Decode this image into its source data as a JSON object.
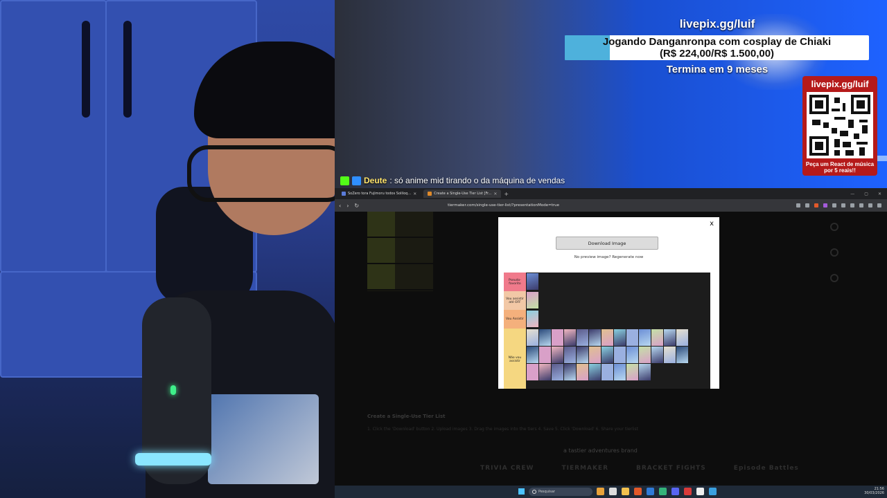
{
  "overlay": {
    "livepix_handle": "livepix.gg/luif",
    "goal_title": "Jogando Danganronpa com cosplay de Chiaki",
    "goal_progress_text": "(R$ 224,00/R$ 1.500,00)",
    "goal_progress_fraction": 0.149,
    "goal_ends": "Termina em 9 meses",
    "qr_title": "livepix.gg/luif",
    "qr_caption": "Peça um React de música por 5 reais!!"
  },
  "chat": {
    "username": "Deute",
    "message": ": só anime mid tirando o da máquina de vendas"
  },
  "browser": {
    "tabs": [
      {
        "label": "SoZero tora Fujimoru todos Soliloq...",
        "active": false
      },
      {
        "label": "Create a Single-Use Tier List [Fr...",
        "active": true
      }
    ],
    "url": "tiermaker.com/single-use-tier-list/?presentationMode=true",
    "modal": {
      "close": "x",
      "download_button": "Download Image",
      "preview_note": "No preview image? Regenerate now",
      "tiers": [
        {
          "label": "Pseudo-favorito",
          "color": "#f07a8b",
          "thumbs": 1
        },
        {
          "label": "Vou assistir até OFF",
          "color": "#f2c8a6",
          "thumbs": 1
        },
        {
          "label": "Vou Assistir",
          "color": "#f4b07c",
          "thumbs": 1
        },
        {
          "label": "Não vou assistir",
          "color": "#f5d781",
          "thumbs": 36
        }
      ]
    },
    "page": {
      "section_title": "Create a Single-Use Tier List",
      "steps": "1. Click the 'Download' button   2. Upload images   3. Drag the images into the tiers   4. Save  5. Click 'Download'   6. Share your tierlist",
      "brand_line": "a tastier adventures brand",
      "brands": [
        "TRIVIA CREW",
        "TIERMAKER",
        "BRACKET FIGHTS",
        "Episode Battles"
      ]
    }
  },
  "taskbar": {
    "search_placeholder": "Pesquisar",
    "time": "21:56",
    "date": "30/03/2026"
  }
}
